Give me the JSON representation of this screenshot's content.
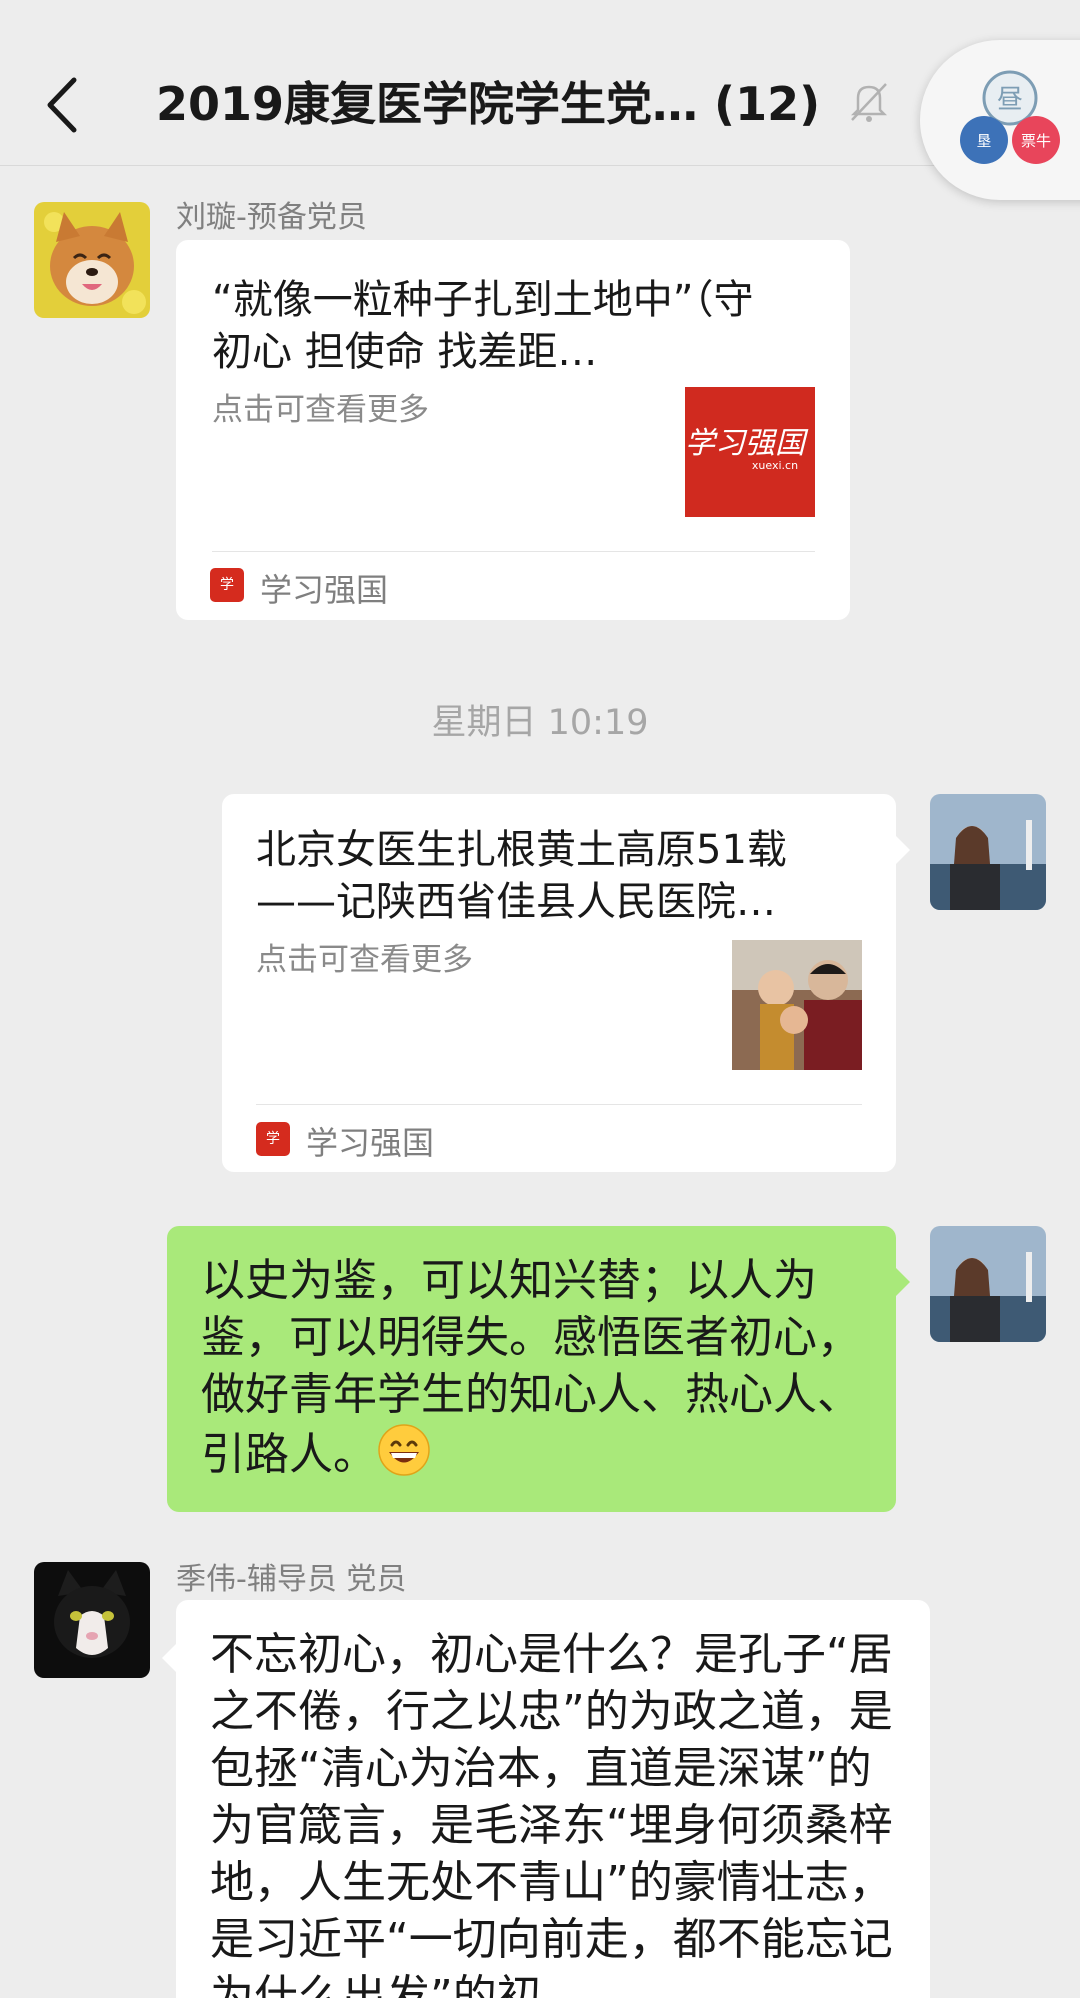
{
  "header": {
    "title": "2019康复医学院学生党…  (12)",
    "back_icon": "chevron-left-icon",
    "mute_icon": "bell-off-icon",
    "mini_program_labels": [
      "昼",
      "垦",
      "票牛"
    ]
  },
  "messages": [
    {
      "type": "link-card",
      "side": "left",
      "sender": "刘璇-预备党员",
      "title": "“就像一粒种子扎到土地中”（守初心 担使命 找差距…",
      "desc": "点击可查看更多",
      "thumb_text": "学习强国",
      "thumb_subtext": "xuexi.cn",
      "source": "学习强国"
    },
    {
      "type": "timestamp",
      "text": "星期日 10:19"
    },
    {
      "type": "link-card",
      "side": "right",
      "title": "北京女医生扎根黄土高原51载——记陕西省佳县人民医院…",
      "desc": "点击可查看更多",
      "source": "学习强国"
    },
    {
      "type": "text",
      "side": "right",
      "text": "以史为鉴，可以知兴替；以人为鉴，可以明得失。感悟医者初心，做好青年学生的知心人、热心人、引路人。",
      "emoji": "grinning-face"
    },
    {
      "type": "text",
      "side": "left",
      "sender": "季伟-辅导员 党员",
      "text": "不忘初心，初心是什么？是孔子“居之不倦，行之以忠”的为政之道，是包拯“清心为治本，直道是深谋”的为官箴言，是毛泽东“埋身何须桑梓地，人生无处不青山”的豪情壮志，是习近平“一切向前走，都不能忘记为什么出发”的初"
    }
  ],
  "colors": {
    "background": "#ededed",
    "bubble_self": "#a9e97a",
    "bubble_other": "#ffffff",
    "source_red": "#d52b1e"
  }
}
